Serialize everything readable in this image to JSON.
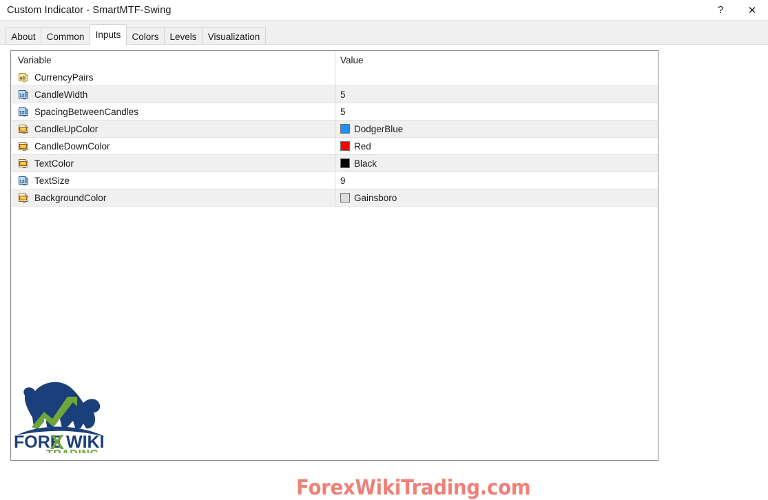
{
  "window": {
    "title": "Custom Indicator - SmartMTF-Swing",
    "help_label": "?",
    "close_label": "✕"
  },
  "tabs": [
    {
      "label": "About",
      "active": false
    },
    {
      "label": "Common",
      "active": false
    },
    {
      "label": "Inputs",
      "active": true
    },
    {
      "label": "Colors",
      "active": false
    },
    {
      "label": "Levels",
      "active": false
    },
    {
      "label": "Visualization",
      "active": false
    }
  ],
  "grid": {
    "headers": {
      "variable": "Variable",
      "value": "Value"
    },
    "rows": [
      {
        "icon": "string-type-icon",
        "variable": "CurrencyPairs",
        "value": "",
        "swatch": null,
        "shaded": false
      },
      {
        "icon": "integer-type-icon",
        "variable": "CandleWidth",
        "value": "5",
        "swatch": null,
        "shaded": true
      },
      {
        "icon": "integer-type-icon",
        "variable": "SpacingBetweenCandles",
        "value": "5",
        "swatch": null,
        "shaded": false
      },
      {
        "icon": "color-type-icon",
        "variable": "CandleUpColor",
        "value": "DodgerBlue",
        "swatch": "#1E90FF",
        "shaded": true
      },
      {
        "icon": "color-type-icon",
        "variable": "CandleDownColor",
        "value": "Red",
        "swatch": "#FF0000",
        "shaded": false
      },
      {
        "icon": "color-type-icon",
        "variable": "TextColor",
        "value": "Black",
        "swatch": "#000000",
        "shaded": true
      },
      {
        "icon": "integer-type-icon",
        "variable": "TextSize",
        "value": "9",
        "swatch": null,
        "shaded": false
      },
      {
        "icon": "color-type-icon",
        "variable": "BackgroundColor",
        "value": "Gainsboro",
        "swatch": "#DCDCDC",
        "shaded": true
      }
    ]
  },
  "logo": {
    "text_forex": "FORE",
    "text_x": "X",
    "text_wiki": "WIKI",
    "text_trading": "TRADING",
    "color_navy": "#1B3F7A",
    "color_green": "#6FA63C"
  },
  "watermark": {
    "text": "ForexWikiTrading.com",
    "color": "#ef8077"
  }
}
